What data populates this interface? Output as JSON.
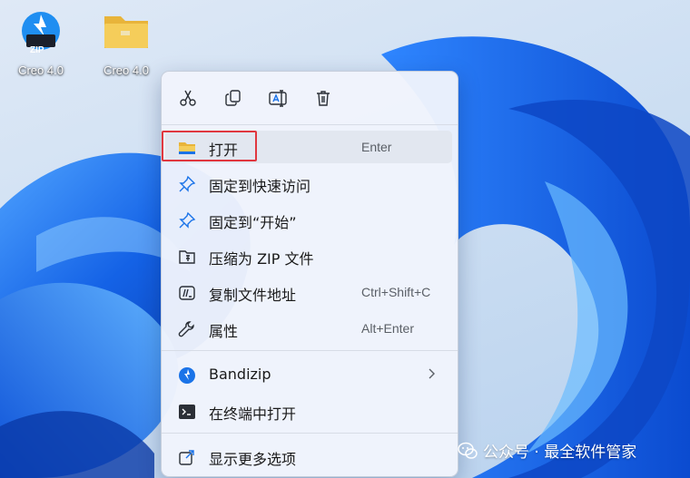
{
  "desktop": {
    "icons": [
      {
        "label": "Creo 4.0",
        "type": "zip",
        "badge": "ZIP"
      },
      {
        "label": "Creo 4.0",
        "type": "folder"
      }
    ]
  },
  "context_menu": {
    "toolbar": [
      {
        "name": "cut",
        "icon": "scissors-icon"
      },
      {
        "name": "copy",
        "icon": "copy-icon"
      },
      {
        "name": "rename",
        "icon": "rename-icon"
      },
      {
        "name": "delete",
        "icon": "trash-icon"
      }
    ],
    "items": [
      {
        "label": "打开",
        "shortcut": "Enter",
        "icon": "folder-icon"
      },
      {
        "label": "固定到快速访问",
        "shortcut": "",
        "icon": "pin-icon"
      },
      {
        "label": "固定到“开始”",
        "shortcut": "",
        "icon": "pin-icon"
      },
      {
        "label": "压缩为 ZIP 文件",
        "shortcut": "",
        "icon": "zip-folder-icon"
      },
      {
        "label": "复制文件地址",
        "shortcut": "Ctrl+Shift+C",
        "icon": "path-icon"
      },
      {
        "label": "属性",
        "shortcut": "Alt+Enter",
        "icon": "wrench-icon"
      },
      {
        "label": "Bandizip",
        "shortcut": "",
        "icon": "bandizip-icon",
        "submenu": true
      },
      {
        "label": "在终端中打开",
        "shortcut": "",
        "icon": "terminal-icon"
      },
      {
        "label": "显示更多选项",
        "shortcut": "",
        "icon": "more-options-icon"
      }
    ]
  },
  "watermark": {
    "text": "公众号 · 最全软件管家",
    "icon": "wechat-icon"
  },
  "colors": {
    "highlight": "#e0373f",
    "accent": "#1a73e8",
    "folder": "#f2c445"
  }
}
